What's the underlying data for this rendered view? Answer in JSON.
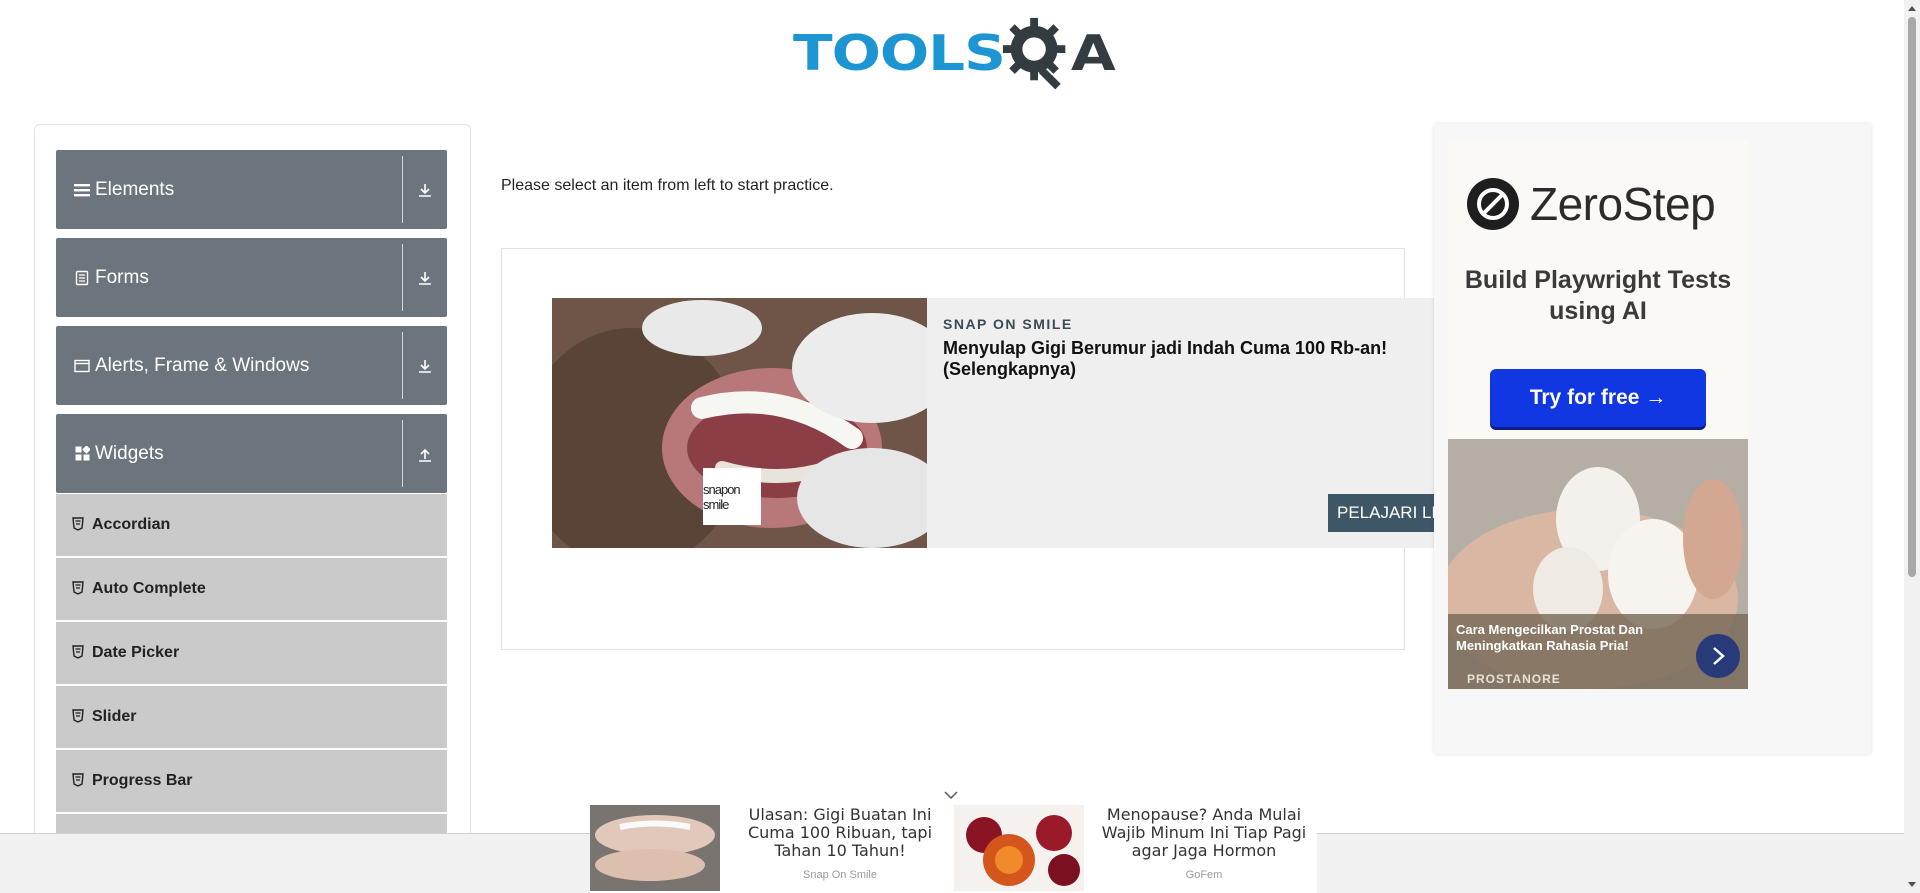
{
  "header": {
    "logo_text_left": "TOOLS",
    "logo_text_right": "A"
  },
  "sidebar": {
    "groups": [
      {
        "label": "Elements",
        "icon": "hamburger-icon",
        "expanded": false
      },
      {
        "label": "Forms",
        "icon": "document-icon",
        "expanded": false
      },
      {
        "label": "Alerts, Frame & Windows",
        "icon": "window-icon",
        "expanded": false
      },
      {
        "label": "Widgets",
        "icon": "widgets-icon",
        "expanded": true
      }
    ],
    "widget_items": [
      {
        "label": "Accordian"
      },
      {
        "label": "Auto Complete"
      },
      {
        "label": "Date Picker"
      },
      {
        "label": "Slider"
      },
      {
        "label": "Progress Bar"
      },
      {
        "label": ""
      }
    ]
  },
  "main": {
    "instruction": "Please select an item from left to start practice."
  },
  "center_ad": {
    "brand": "SNAP ON SMILE",
    "headline": "Menyulap Gigi Berumur jadi Indah Cuma 100 Rb-an! (Selengkapnya)",
    "cta": "PELAJARI LEBIH LANJUT",
    "logo_text": "snapon smile"
  },
  "right_ad": {
    "zerostep_name": "ZeroStep",
    "zerostep_tagline": "Build Playwright Tests using AI",
    "zerostep_button": "Try for free →",
    "egg_headline": "Cara Mengecilkan Prostat Dan Meningkatkan Rahasia Pria!",
    "egg_brand": "PROSTANORE"
  },
  "bottom_ad": {
    "cards": [
      {
        "title": "Ulasan: Gigi Buatan Ini Cuma 100 Ribuan, tapi Tahan 10 Tahun!",
        "source": "Snap On Smile"
      },
      {
        "title": "Menopause? Anda Mulai Wajib Minum Ini Tiap Pagi agar Jaga Hormon",
        "source": "GoFem"
      }
    ]
  },
  "colors": {
    "group_header": "#6c757d",
    "menu_item": "#cacaca",
    "logo_blue": "#1d95d2",
    "logo_dark": "#333c41",
    "zerostep_button": "#1137e3",
    "ad_cta": "#3f5667"
  }
}
